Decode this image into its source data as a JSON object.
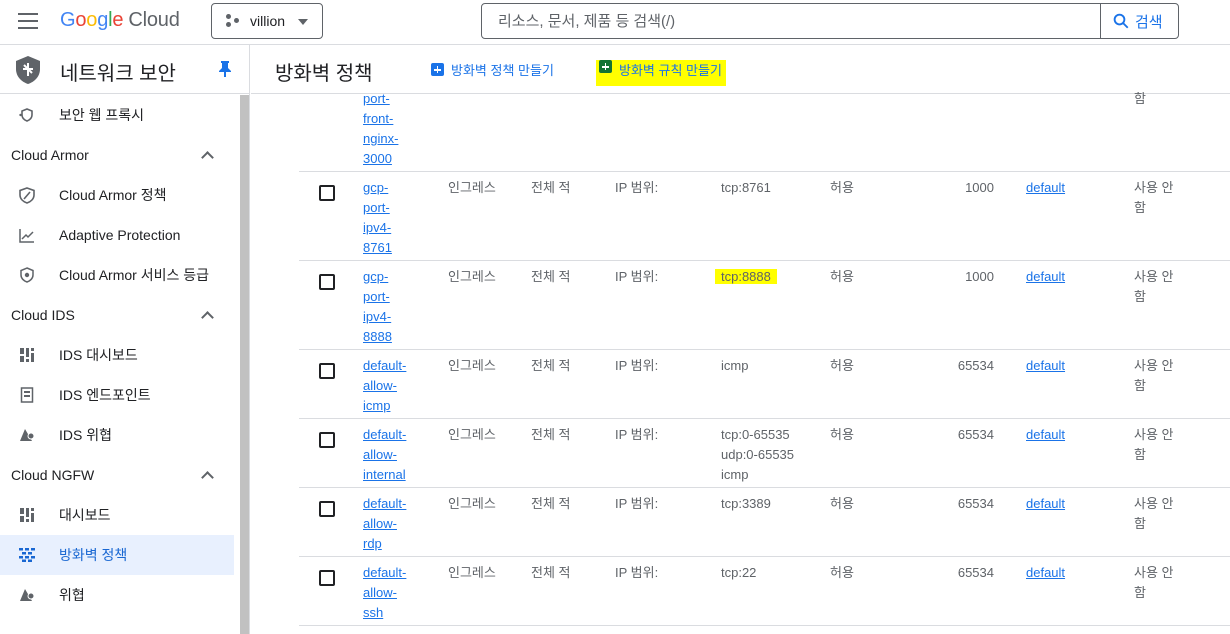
{
  "topbar": {
    "logo_cloud": "Cloud",
    "project": "villion",
    "search_placeholder": "리소스, 문서, 제품 등 검색(/)",
    "search_button": "검색"
  },
  "sidebar": {
    "title": "네트워크 보안",
    "items": [
      {
        "label": "보안 웹 프록시",
        "icon": "proxy-icon"
      },
      {
        "group": "Cloud Armor"
      },
      {
        "label": "Cloud Armor 정책",
        "icon": "shield-icon"
      },
      {
        "label": "Adaptive Protection",
        "icon": "chart-icon"
      },
      {
        "label": "Cloud Armor 서비스 등급",
        "icon": "badge-icon"
      },
      {
        "group": "Cloud IDS"
      },
      {
        "label": "IDS 대시보드",
        "icon": "dashboard-icon"
      },
      {
        "label": "IDS 엔드포인트",
        "icon": "endpoint-icon"
      },
      {
        "label": "IDS 위협",
        "icon": "threat-icon"
      },
      {
        "group": "Cloud NGFW"
      },
      {
        "label": "대시보드",
        "icon": "dashboard-icon"
      },
      {
        "label": "방화벽 정책",
        "icon": "firewall-icon",
        "active": true
      },
      {
        "label": "위협",
        "icon": "threat-icon"
      }
    ]
  },
  "main": {
    "title": "방화벽 정책",
    "actions": {
      "create_policy": "방화벽 정책 만들기",
      "create_rule": "방화벽 규칙 만들기"
    },
    "rows": [
      {
        "name": [
          "port-",
          "front-",
          "nginx-",
          "3000"
        ],
        "direction": "",
        "scope": "",
        "source": "",
        "protocols": [],
        "action": "",
        "priority": "",
        "network": "",
        "logs": [
          "함"
        ]
      },
      {
        "name": [
          "gcp-",
          "port-",
          "ipv4-",
          "8761"
        ],
        "direction": "인그레스",
        "scope": "전체 적",
        "source": "IP 범위:",
        "protocols": [
          "tcp:8761"
        ],
        "action": "허용",
        "priority": "1000",
        "network": "default",
        "logs": [
          "사용 안",
          "함"
        ]
      },
      {
        "name": [
          "gcp-",
          "port-",
          "ipv4-",
          "8888"
        ],
        "direction": "인그레스",
        "scope": "전체 적",
        "source": "IP 범위:",
        "protocols": [
          "tcp:8888"
        ],
        "highlight_protocol": true,
        "action": "허용",
        "priority": "1000",
        "network": "default",
        "logs": [
          "사용 안",
          "함"
        ]
      },
      {
        "name": [
          "default-",
          "allow-",
          "icmp"
        ],
        "direction": "인그레스",
        "scope": "전체 적",
        "source": "IP 범위:",
        "protocols": [
          "icmp"
        ],
        "action": "허용",
        "priority": "65534",
        "network": "default",
        "logs": [
          "사용 안",
          "함"
        ]
      },
      {
        "name": [
          "default-",
          "allow-",
          "internal"
        ],
        "direction": "인그레스",
        "scope": "전체 적",
        "source": "IP 범위:",
        "protocols": [
          "tcp:0-65535",
          "udp:0-65535",
          "icmp"
        ],
        "action": "허용",
        "priority": "65534",
        "network": "default",
        "logs": [
          "사용 안",
          "함"
        ]
      },
      {
        "name": [
          "default-",
          "allow-",
          "rdp"
        ],
        "direction": "인그레스",
        "scope": "전체 적",
        "source": "IP 범위:",
        "protocols": [
          "tcp:3389"
        ],
        "action": "허용",
        "priority": "65534",
        "network": "default",
        "logs": [
          "사용 안",
          "함"
        ]
      },
      {
        "name": [
          "default-",
          "allow-",
          "ssh"
        ],
        "direction": "인그레스",
        "scope": "전체 적",
        "source": "IP 범위:",
        "protocols": [
          "tcp:22"
        ],
        "action": "허용",
        "priority": "65534",
        "network": "default",
        "logs": [
          "사용 안",
          "함"
        ]
      }
    ]
  }
}
